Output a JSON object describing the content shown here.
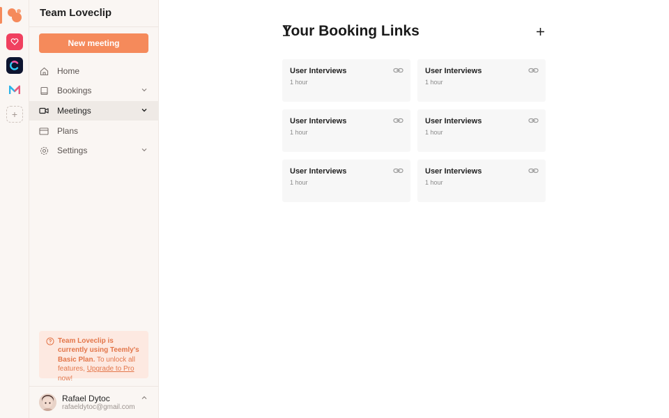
{
  "workspace_rail": {
    "items": [
      {
        "name": "loveclip",
        "icon": "team-blob-icon",
        "color": "#f58a5b",
        "active": true
      },
      {
        "name": "heart-app",
        "icon": "heart-logo-icon",
        "color": "#f0405f"
      },
      {
        "name": "c-app",
        "icon": "c-logo-icon",
        "color": "#0e1530"
      },
      {
        "name": "m-app",
        "icon": "m-logo-icon",
        "color": "#2bb3e8"
      }
    ],
    "add_label": "+"
  },
  "sidebar": {
    "team_name": "Team Loveclip",
    "new_meeting_label": "New meeting",
    "nav": [
      {
        "label": "Home",
        "icon": "home-icon",
        "has_chevron": false,
        "active": false
      },
      {
        "label": "Bookings",
        "icon": "book-icon",
        "has_chevron": true,
        "active": false
      },
      {
        "label": "Meetings",
        "icon": "video-icon",
        "has_chevron": true,
        "active": true
      },
      {
        "label": "Plans",
        "icon": "credit-card-icon",
        "has_chevron": false,
        "active": false
      },
      {
        "label": "Settings",
        "icon": "gear-icon",
        "has_chevron": true,
        "active": false
      }
    ],
    "plan_notice": {
      "strong_part": "Team Loveclip is currently using Teemly's Basic Plan.",
      "normal_part": "To unlock all features,",
      "link_text": "Upgrade to Pro",
      "suffix": "now!"
    },
    "user": {
      "name": "Rafael Dytoc",
      "email": "rafaeldytoc@gmail.com"
    }
  },
  "main": {
    "title": "Your Booking Links",
    "add_label": "+",
    "cards": [
      {
        "title": "User Interviews",
        "duration": "1 hour"
      },
      {
        "title": "User Interviews",
        "duration": "1 hour"
      },
      {
        "title": "User Interviews",
        "duration": "1 hour"
      },
      {
        "title": "User Interviews",
        "duration": "1 hour"
      },
      {
        "title": "User Interviews",
        "duration": "1 hour"
      },
      {
        "title": "User Interviews",
        "duration": "1 hour"
      }
    ]
  },
  "colors": {
    "accent": "#f58a5b",
    "sidebar_bg": "#faf6f3",
    "card_bg": "#f7f7f7",
    "notice_bg": "#fde9e1",
    "notice_text": "#e3764a"
  }
}
